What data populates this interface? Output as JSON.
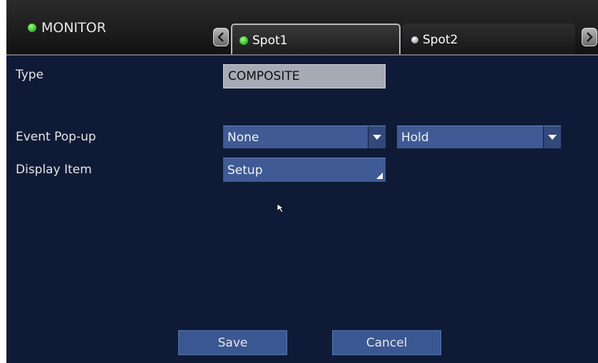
{
  "header": {
    "title": "MONITOR",
    "tabs": [
      {
        "label": "Spot1",
        "active": true,
        "status_color": "#3dd13a"
      },
      {
        "label": "Spot2",
        "active": false,
        "status_color": "#b8c0ca"
      }
    ],
    "prev_icon": "chevron-left-icon",
    "next_icon": "chevron-right-icon"
  },
  "form": {
    "type": {
      "label": "Type",
      "value": "COMPOSITE"
    },
    "event_popup": {
      "label": "Event Pop-up",
      "value": "None",
      "duration_value": "Hold"
    },
    "display_item": {
      "label": "Display Item",
      "value": "Setup"
    }
  },
  "buttons": {
    "save": "Save",
    "cancel": "Cancel"
  },
  "colors": {
    "background": "#0f1b36",
    "control": "#3f5a94",
    "accent_green": "#3dd13a"
  }
}
